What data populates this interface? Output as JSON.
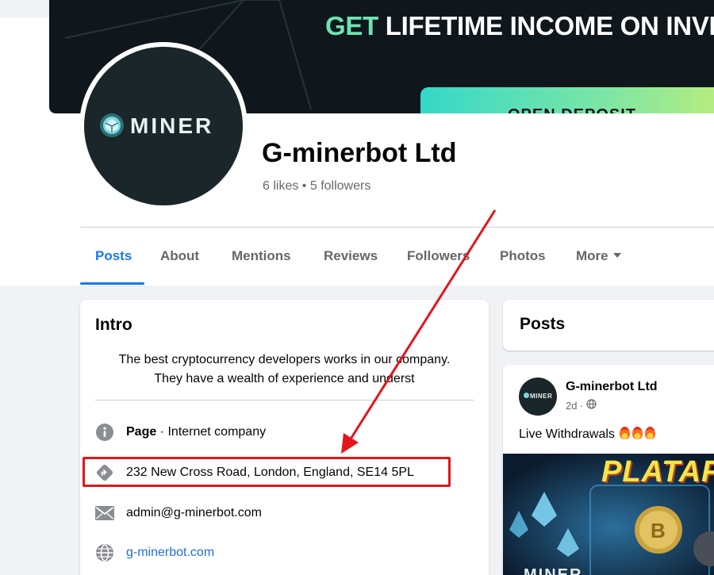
{
  "cover": {
    "headline_accent": "GET",
    "headline_rest": " LIFETIME INCOME ON INVE",
    "button_label": "OPEN DEPOSIT"
  },
  "page": {
    "avatar_logo_text": "MINER",
    "name": "G-minerbot Ltd",
    "stats": "6 likes • 5 followers"
  },
  "tabs": [
    {
      "label": "Posts",
      "active": true
    },
    {
      "label": "About"
    },
    {
      "label": "Mentions"
    },
    {
      "label": "Reviews"
    },
    {
      "label": "Followers"
    },
    {
      "label": "Photos"
    },
    {
      "label": "More"
    }
  ],
  "intro": {
    "title": "Intro",
    "bio_line1": "The best cryptocurrency developers works in our company.",
    "bio_line2": "They have a wealth of experience and underst",
    "category_label": "Page",
    "category_value": " · Internet company",
    "address": "232 New Cross Road, London, England, SE14 5PL",
    "email": "admin@g-minerbot.com",
    "website": "g-minerbot.com"
  },
  "posts_section": {
    "title": "Posts"
  },
  "post": {
    "avatar_text": "MINER",
    "author": "G-minerbot Ltd",
    "time": "2d",
    "separator": "·",
    "text": "Live Withdrawals",
    "image_headline": "PLATAFO",
    "image_logo": "MINER"
  },
  "colors": {
    "accent_blue": "#1877f2",
    "annotation_red": "#e5141b",
    "link_blue": "#216fdb"
  },
  "icons": {
    "info": "info-circle-icon",
    "address": "directions-icon",
    "email": "envelope-icon",
    "website": "globe-icon",
    "privacy": "globe-icon",
    "more": "caret-down-icon"
  }
}
